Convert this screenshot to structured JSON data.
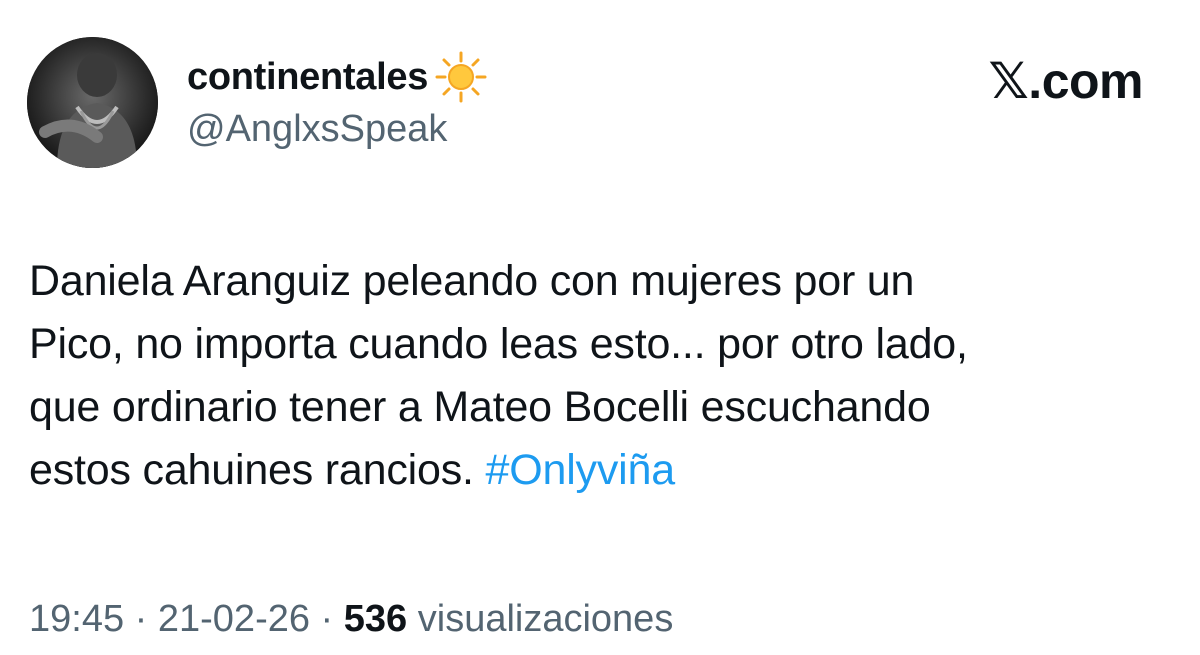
{
  "author": {
    "display_name": "continentales",
    "emoji_icon": "sun-emoji",
    "handle": "@AnglxsSpeak",
    "avatar_icon": "profile-photo"
  },
  "site": {
    "label": "𝕏.com"
  },
  "tweet": {
    "lines": [
      "Daniela Aranguiz peleando con mujeres por un",
      "Pico, no importa cuando leas esto... por otro lado,",
      "que ordinario tener a Mateo Bocelli escuchando",
      "estos cahuines rancios."
    ],
    "hashtag": "#Onlyviña"
  },
  "meta": {
    "time": "19:45",
    "sep1": " · ",
    "date": "21-02-26",
    "sep2": " · ",
    "views_count": "536",
    "views_label": " visualizaciones"
  },
  "colors": {
    "text": "#0f1419",
    "secondary": "#536471",
    "link": "#1d9bf0"
  }
}
